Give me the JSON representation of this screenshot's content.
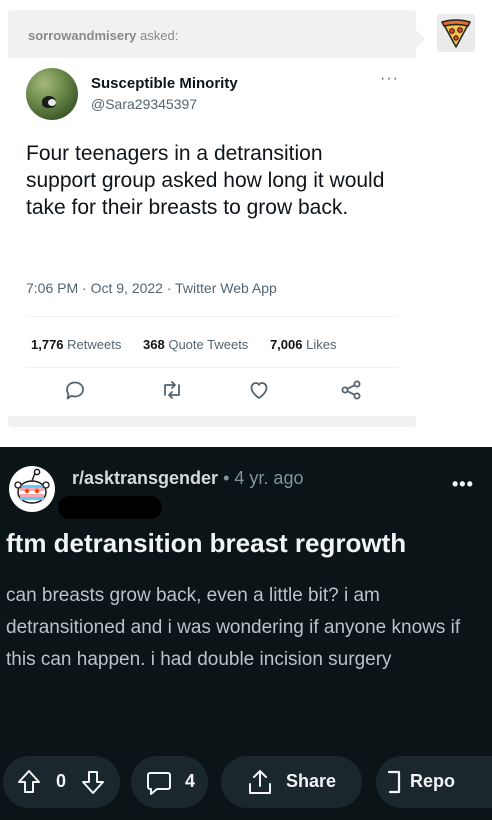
{
  "tumblr_ask": {
    "asker": "sorrowandmisery",
    "asked_label": "asked:",
    "asker_avatar_icon": "pizza-slice-icon"
  },
  "tweet": {
    "display_name": "Susceptible Minority",
    "handle": "@Sara29345397",
    "more": "···",
    "text": "Four teenagers in a detransition support group asked how long it would take for their breasts to grow back.",
    "meta": "7:06 PM · Oct 9, 2022 · Twitter Web App",
    "stats": {
      "retweets_count": "1,776",
      "retweets_label": "Retweets",
      "quote_count": "368",
      "quote_label": "Quote Tweets",
      "likes_count": "7,006",
      "likes_label": "Likes"
    },
    "action_icons": [
      "reply-icon",
      "retweet-icon",
      "like-icon",
      "share-icon"
    ]
  },
  "reddit_post": {
    "subreddit": "r/asktransgender",
    "separator": "•",
    "age": "4 yr. ago",
    "more": "•••",
    "title": "ftm detransition breast regrowth",
    "body": "can breasts grow back, even a little bit? i am detransitioned and i was wondering if anyone knows if this can happen. i had double incision surgery",
    "vote_count": "0",
    "comment_count": "4",
    "share_label": "Share",
    "report_label": "Repo",
    "colors": {
      "background": "#0b1416",
      "pill": "#1a282d",
      "title": "#f2f4f5",
      "body": "#b7c4c8"
    }
  }
}
